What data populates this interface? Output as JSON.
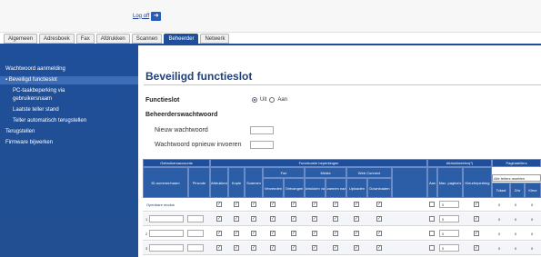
{
  "topbar": {
    "logout_label": "Log off",
    "logout_icon": "arrow-right-icon"
  },
  "tabs": [
    {
      "label": "Algemeen",
      "active": false
    },
    {
      "label": "Adresboek",
      "active": false
    },
    {
      "label": "Fax",
      "active": false
    },
    {
      "label": "Afdrukken",
      "active": false
    },
    {
      "label": "Scannen",
      "active": false
    },
    {
      "label": "Beheerder",
      "active": true
    },
    {
      "label": "Netwerk",
      "active": false
    }
  ],
  "sidebar": {
    "items": [
      {
        "label": "Wachtwoord aanmelding",
        "level": "top"
      },
      {
        "label": "Beveiligd functieslot",
        "level": "active"
      },
      {
        "label": "PC-taakbeperking via",
        "level": "sub"
      },
      {
        "label": "gebruikersnaam",
        "level": "sub"
      },
      {
        "label": "Laatste teller stand",
        "level": "sub"
      },
      {
        "label": "Teller automatisch terugstellen",
        "level": "sub"
      },
      {
        "label": "Terugstellen",
        "level": "top"
      },
      {
        "label": "Firmware bijwerken",
        "level": "top"
      }
    ]
  },
  "main": {
    "title": "Beveiligd functieslot",
    "functieslot_label": "Functieslot",
    "radio_off": "Uit",
    "radio_on": "Aan",
    "radio_selected": "Uit",
    "admin_pw_label": "Beheerderswachtwoord",
    "new_pw_label": "Nieuw wachtwoord",
    "confirm_pw_label": "Wachtwoord opnieuw invoeren"
  },
  "table": {
    "headers": {
      "accounts": "Gebruikersaccounts",
      "restrictions": "Functionele beperkingen",
      "print_limit": "Afdruklimieten(*)",
      "counters": "Paginatellers",
      "fax": "Fax",
      "media": "Media",
      "webconnect": "Web Connect",
      "id_name": "ID-nummer/naam",
      "pincode": "Pincode",
      "print": "Afdrukken",
      "copy": "Kopie",
      "scan": "Scannen",
      "fax_send": "Verzenden",
      "fax_receive": "Ontvangen",
      "media_print": "Afdrukken van",
      "media_scan": "Scannen naar",
      "wc_upload": "Uploaden",
      "wc_download": "Downloaden",
      "on": "Aan",
      "max_pages": "Max. pagina's",
      "color_limit": "Kleurbeperking",
      "total": "Totaal",
      "bw": "Z/w",
      "color": "Kleur",
      "reset_select": "Alle tellers resetten"
    },
    "rows": [
      {
        "label": "Openbare modus",
        "num": "",
        "max": "0",
        "counters": [
          "0",
          "0",
          "0"
        ]
      },
      {
        "label": "",
        "num": "1",
        "max": "0",
        "counters": [
          "0",
          "0",
          "0"
        ]
      },
      {
        "label": "",
        "num": "2",
        "max": "0",
        "counters": [
          "0",
          "0",
          "0"
        ]
      },
      {
        "label": "",
        "num": "3",
        "max": "0",
        "counters": [
          "0",
          "0",
          "0"
        ]
      }
    ]
  },
  "colors": {
    "brand": "#1f4f9a",
    "sidebar": "#1f4f9a",
    "title": "#1f3f7a"
  }
}
